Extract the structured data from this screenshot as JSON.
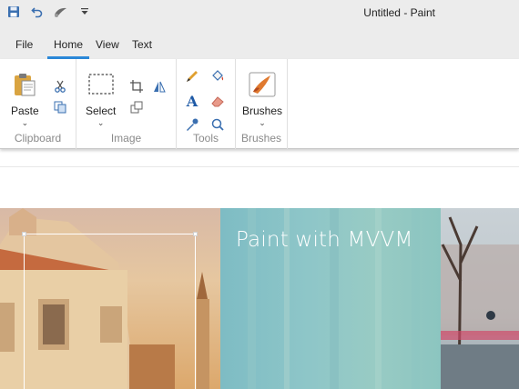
{
  "window": {
    "title": "Untitled - Paint"
  },
  "quick_access": [
    "save-icon",
    "undo-icon",
    "brush-icon",
    "customize-dropdown-icon"
  ],
  "tabs": [
    {
      "label": "File",
      "active": false
    },
    {
      "label": "Home",
      "active": true
    },
    {
      "label": "View",
      "active": false
    },
    {
      "label": "Text",
      "active": false
    }
  ],
  "ribbon": {
    "clipboard": {
      "label": "Clipboard",
      "paste_label": "Paste",
      "small_icons": [
        "cut-icon",
        "copy-icon"
      ]
    },
    "image": {
      "label": "Image",
      "select_label": "Select",
      "small_icons": [
        "crop-icon",
        "rotate-icon",
        "resize-icon"
      ]
    },
    "tools": {
      "label": "Tools",
      "icons": [
        "pencil-icon",
        "fill-icon",
        "text-icon",
        "eraser-icon",
        "color-picker-icon",
        "magnifier-icon"
      ],
      "text_glyph": "A"
    },
    "brushes": {
      "label": "Brushes",
      "button_label": "Brushes"
    }
  },
  "canvas": {
    "hero_text": "Paint with MVVM"
  },
  "colors": {
    "accent": "#2b88d8",
    "chrome": "#ececec",
    "group_label": "#8a8a8a"
  }
}
